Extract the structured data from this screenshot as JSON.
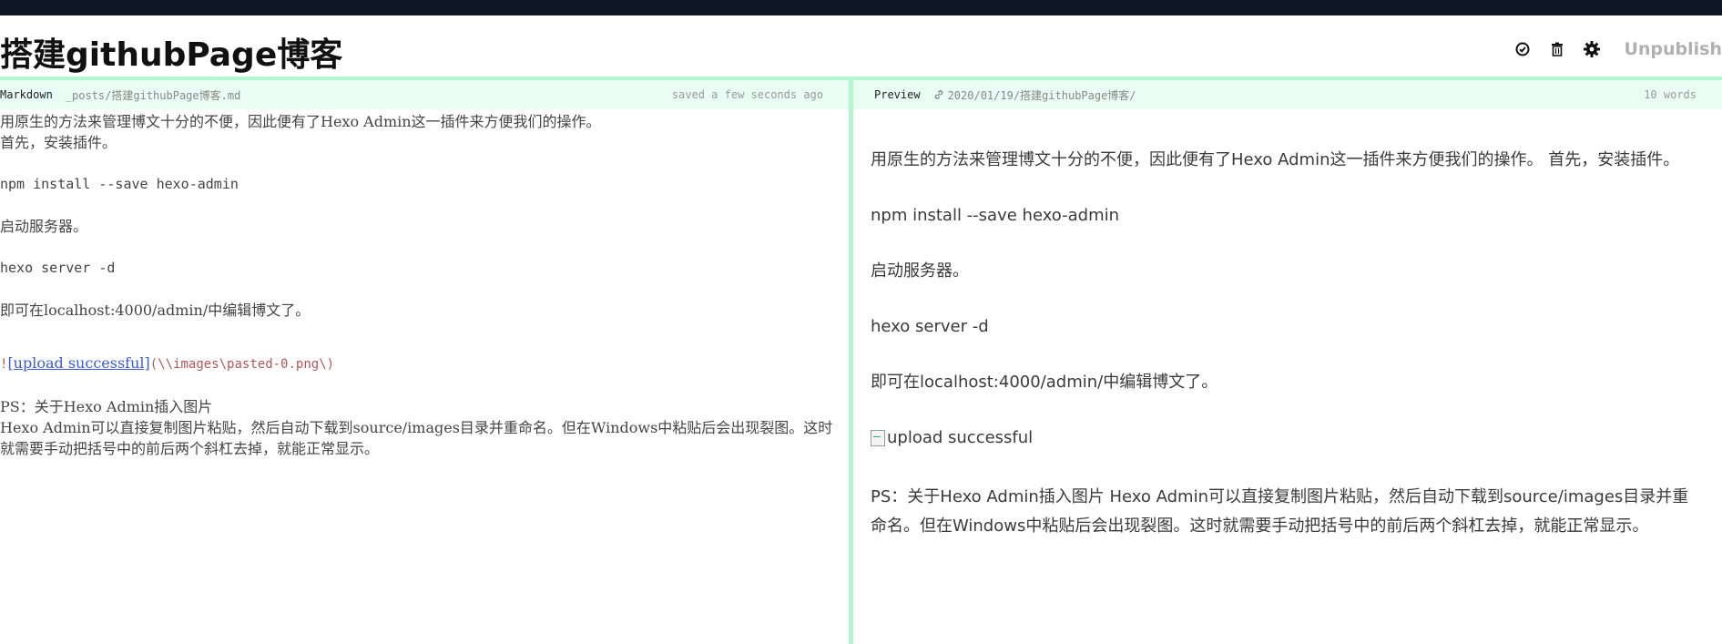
{
  "header": {
    "title": "搭建githubPage博客",
    "icons": [
      "check-circle-icon",
      "trash-icon",
      "gear-icon"
    ],
    "unpublish_label": "Unpublish"
  },
  "editor_header": {
    "mode_label": "Markdown",
    "file_path": "_posts/搭建githubPage博客.md",
    "status": "saved a few seconds ago"
  },
  "preview_header": {
    "label": "Preview",
    "link_icon": "link-icon",
    "permalink": "2020/01/19/搭建githubPage博客/",
    "word_count": "10 words"
  },
  "editor": {
    "line1": "用原生的方法来管理博文十分的不便，因此便有了Hexo Admin这一插件来方便我们的操作。",
    "line2": "首先，安装插件。",
    "line3": "npm install --save hexo-admin",
    "line4": "启动服务器。",
    "line5": "hexo server -d",
    "line6": "即可在localhost:4000/admin/中编辑博文了。",
    "image_bang": "!",
    "image_alt": "[upload successful]",
    "image_url": "(\\\\images\\pasted-0.png\\)",
    "line8": "PS：关于Hexo Admin插入图片",
    "line9": "Hexo Admin可以直接复制图片粘贴，然后自动下载到source/images目录并重命名。但在Windows中粘贴后会出现裂图。这时就需要手动把括号中的前后两个斜杠去掉，就能正常显示。"
  },
  "preview": {
    "p1": "用原生的方法来管理博文十分的不便，因此便有了Hexo Admin这一插件来方便我们的操作。 首先，安装插件。",
    "p2": "npm install --save hexo-admin",
    "p3": "启动服务器。",
    "p4": "hexo server -d",
    "p5": "即可在localhost:4000/admin/中编辑博文了。",
    "image_alt": "upload successful",
    "p7": "PS：关于Hexo Admin插入图片 Hexo Admin可以直接复制图片粘贴，然后自动下载到source/images目录并重命名。但在Windows中粘贴后会出现裂图。这时就需要手动把括号中的前后两个斜杠去掉，就能正常显示。"
  },
  "colors": {
    "topbar": "#0f1626",
    "accent_green": "#b2f5cf",
    "header_bg": "#eafdf3"
  }
}
